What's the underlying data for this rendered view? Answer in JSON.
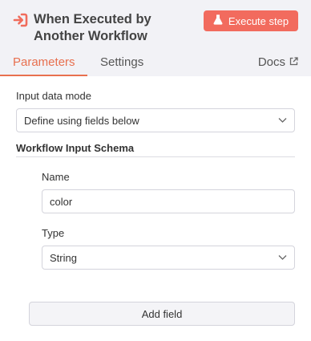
{
  "node": {
    "title": "When Executed by Another Workflow",
    "trigger_icon": "sign-in-arrow-icon",
    "accent_color": "#e8704f"
  },
  "toolbar": {
    "execute_label": "Execute step",
    "execute_icon": "flask-icon",
    "execute_color": "#f26b5e"
  },
  "tabs": [
    {
      "label": "Parameters",
      "active": true
    },
    {
      "label": "Settings",
      "active": false
    }
  ],
  "docs": {
    "label": "Docs",
    "icon": "external-link-icon"
  },
  "params": {
    "input_mode_label": "Input data mode",
    "input_mode_value": "Define using fields below",
    "schema_title": "Workflow Input Schema",
    "field": {
      "name_label": "Name",
      "name_value": "color",
      "type_label": "Type",
      "type_value": "String"
    },
    "add_field_label": "Add field"
  }
}
